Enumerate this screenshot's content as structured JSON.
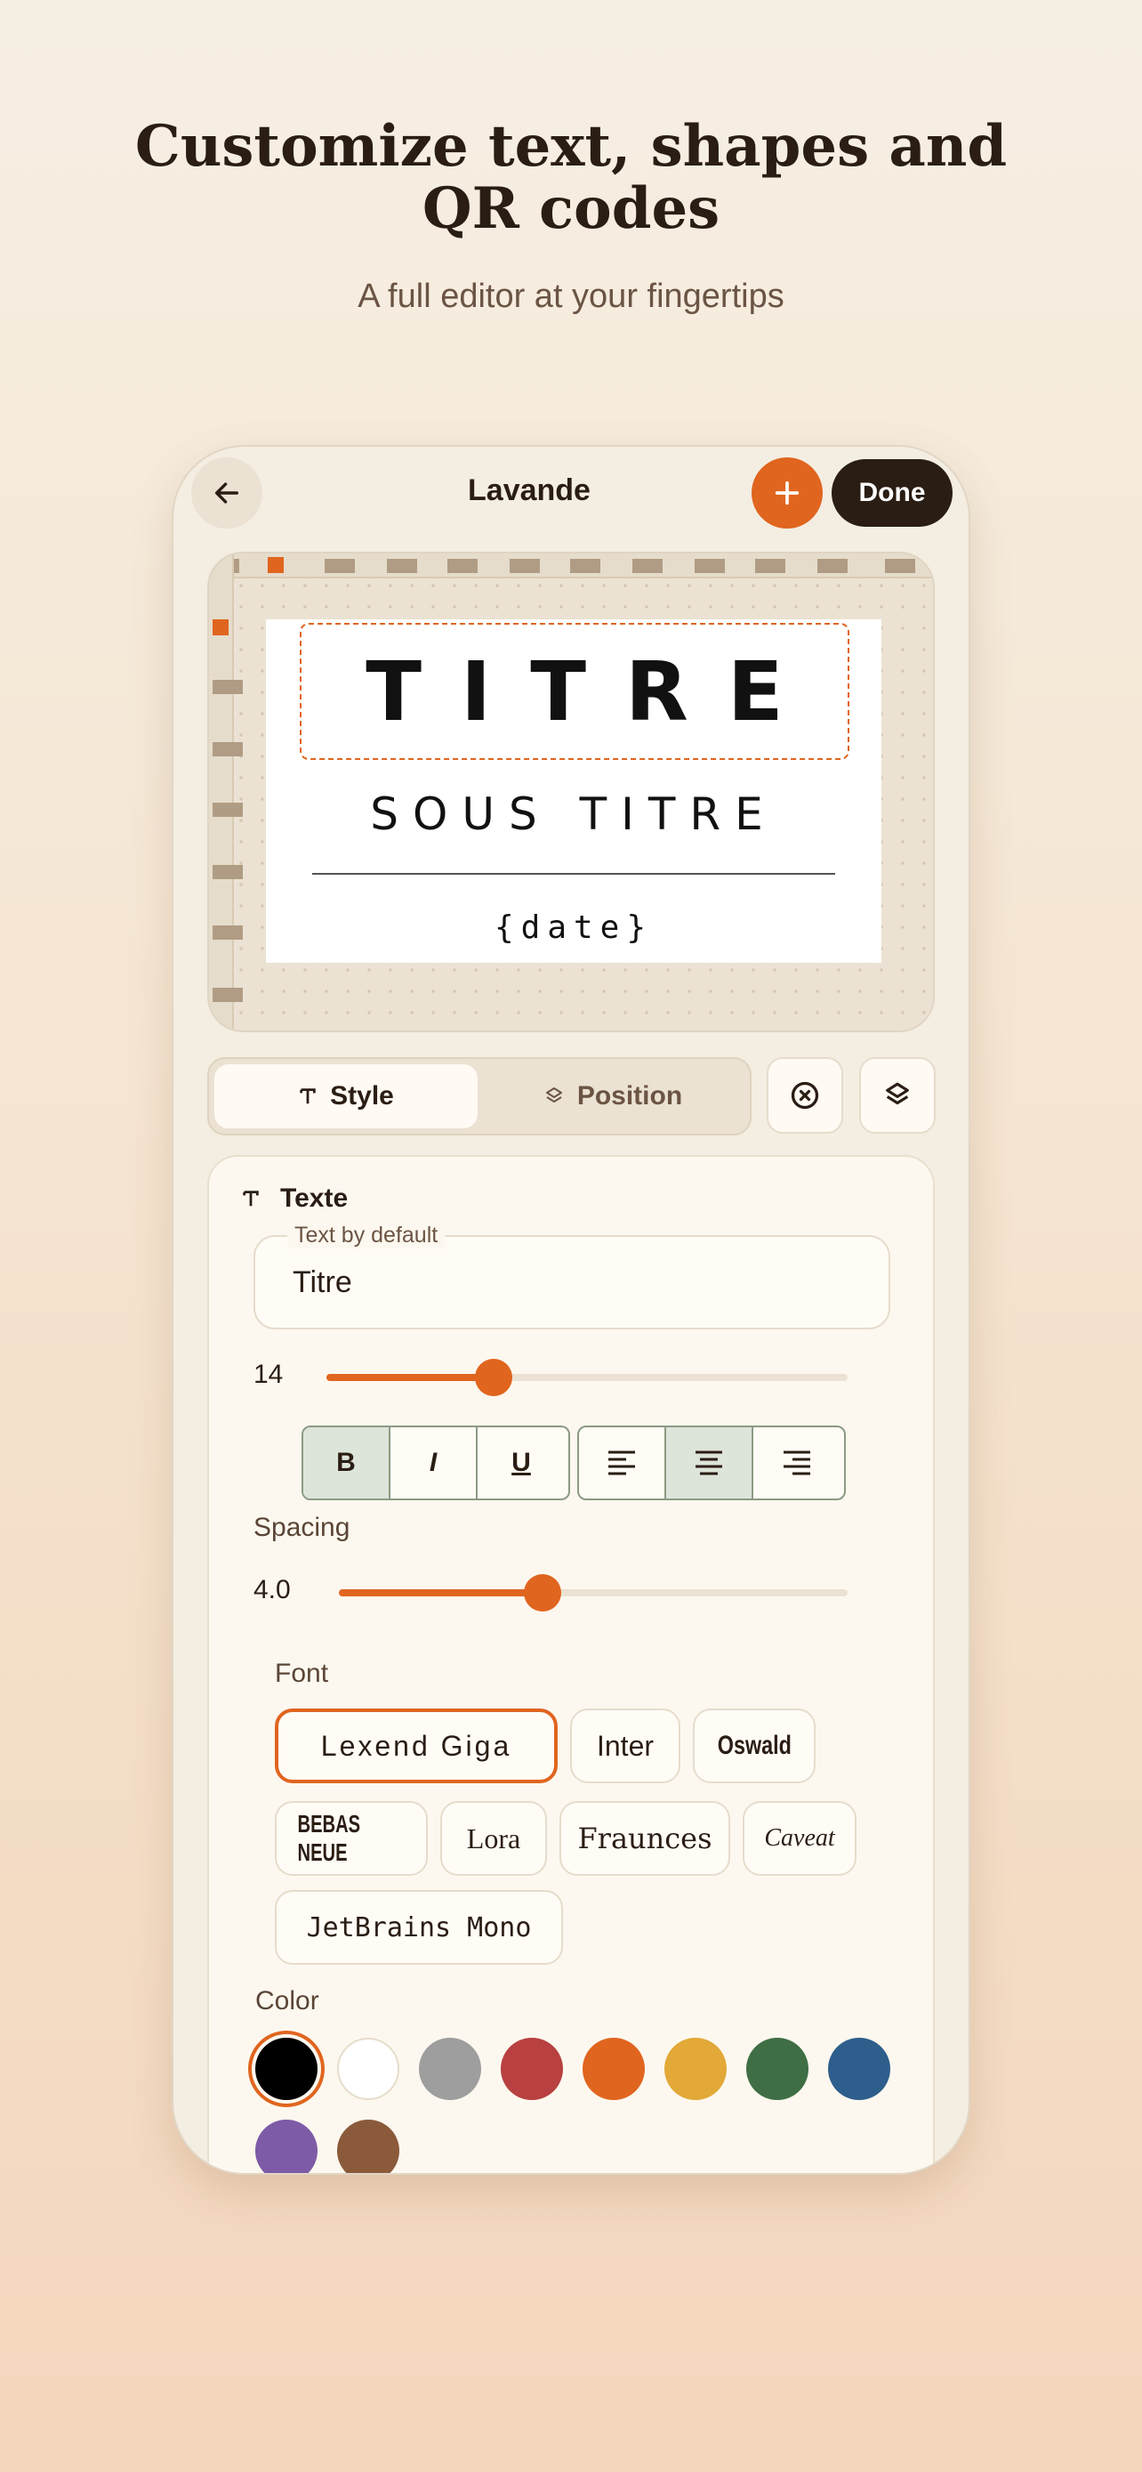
{
  "hero": {
    "title": "Customize text, shapes and QR codes",
    "subtitle": "A full editor at your fingertips"
  },
  "topbar": {
    "title": "Lavande",
    "done_label": "Done",
    "back_icon": "arrow-left-icon",
    "add_icon": "plus-icon"
  },
  "label": {
    "title": "TITRE",
    "subtitle": "SOUS TITRE",
    "date": "{date}"
  },
  "tabs": [
    {
      "label": "Style",
      "icon": "text-t-icon",
      "active": true
    },
    {
      "label": "Position",
      "icon": "layers-icon",
      "active": false
    }
  ],
  "text_section": {
    "heading": "Texte",
    "field_label": "Text by default",
    "field_value": "Titre",
    "size_value": "14",
    "size_fraction": 0.32
  },
  "format_buttons": [
    {
      "label": "B",
      "active": true
    },
    {
      "label": "I",
      "active": false
    },
    {
      "label": "U",
      "active": false
    }
  ],
  "align_buttons": [
    {
      "name": "align-left",
      "active": false
    },
    {
      "name": "align-center",
      "active": true
    },
    {
      "name": "align-right",
      "active": false
    }
  ],
  "spacing": {
    "label": "Spacing",
    "value": "4.0",
    "fraction": 0.4
  },
  "font": {
    "label": "Font",
    "options": [
      "Lexend Giga",
      "Inter",
      "Oswald",
      "BEBAS NEUE",
      "Lora",
      "Fraunces",
      "Caveat",
      "JetBrains Mono"
    ],
    "selected": "Lexend Giga"
  },
  "color": {
    "label": "Color",
    "swatches": [
      "#000000",
      "#ffffff",
      "#9e9e9e",
      "#b84040",
      "#e0651f",
      "#e2a838",
      "#3f6e45",
      "#2e5e8c",
      "#7d5ba6",
      "#8a5a3b"
    ],
    "selected": "#000000"
  },
  "colors": {
    "accent": "#e0651f",
    "dark": "#2a1d14"
  }
}
